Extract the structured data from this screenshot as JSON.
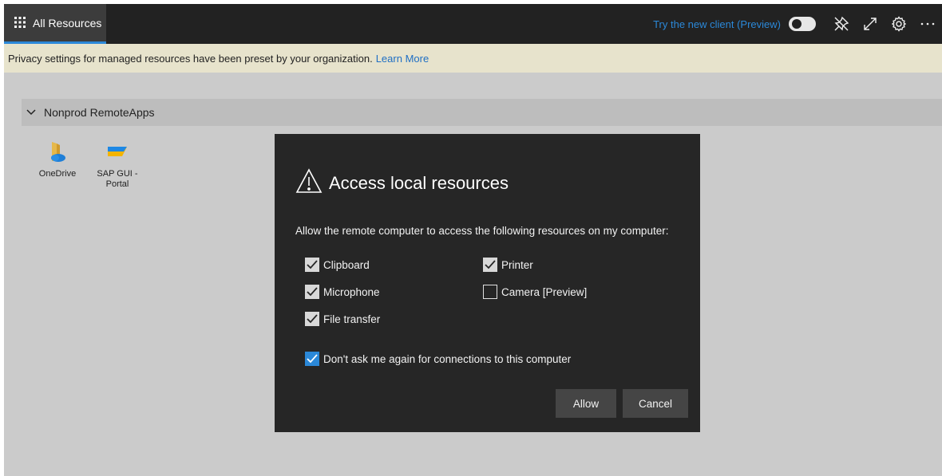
{
  "topbar": {
    "tab_label": "All Resources",
    "try_new_client": "Try the new client (Preview)",
    "icons": [
      "waffle-icon",
      "pin-icon",
      "expand-icon",
      "gear-icon",
      "more-icon"
    ]
  },
  "notice": {
    "text": "Privacy settings for managed resources have been preset by your organization.",
    "link": "Learn More"
  },
  "group": {
    "label": "Nonprod RemoteApps",
    "apps": [
      {
        "name": "OneDrive",
        "icon": "onedrive-icon"
      },
      {
        "name_line1": "SAP GUI -",
        "name_line2": "Portal",
        "icon": "sap-gui-icon"
      }
    ]
  },
  "dialog": {
    "title": "Access local resources",
    "prompt": "Allow the remote computer to access the following resources on my computer:",
    "options": [
      {
        "label": "Clipboard",
        "checked": true
      },
      {
        "label": "Printer",
        "checked": true
      },
      {
        "label": "Microphone",
        "checked": true
      },
      {
        "label": "Camera [Preview]",
        "checked": false
      },
      {
        "label": "File transfer",
        "checked": true
      }
    ],
    "dont_ask": {
      "label": "Don't ask me again for connections to this computer",
      "checked": true
    },
    "allow_label": "Allow",
    "cancel_label": "Cancel"
  },
  "colors": {
    "topbar": "#222222",
    "accent": "#2b88d8",
    "notice_bg": "#e7e3cc",
    "dialog_bg": "#262626",
    "workspace_bg": "#cbcbcb"
  }
}
